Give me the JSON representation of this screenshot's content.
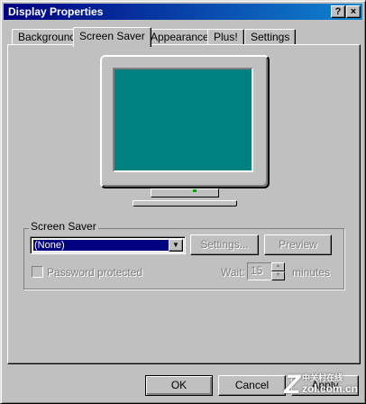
{
  "window": {
    "title": "Display Properties",
    "help_glyph": "?",
    "close_glyph": "×"
  },
  "tabs": [
    {
      "label": "Background",
      "active": false
    },
    {
      "label": "Screen Saver",
      "active": true
    },
    {
      "label": "Appearance",
      "active": false
    },
    {
      "label": "Plus!",
      "active": false
    },
    {
      "label": "Settings",
      "active": false
    }
  ],
  "preview": {
    "screen_color": "#008080"
  },
  "screen_saver": {
    "group_label": "Screen Saver",
    "selected": "(None)",
    "settings_label": "Settings...",
    "preview_label": "Preview",
    "password_label": "Password protected",
    "password_checked": false,
    "wait_label": "Wait:",
    "wait_value": "15",
    "wait_units": "minutes"
  },
  "buttons": {
    "ok": "OK",
    "cancel": "Cancel",
    "apply": "Apply"
  },
  "watermark": {
    "logo": "Z",
    "text_cn": "中关村在线",
    "url": "zol.com.cn"
  },
  "colors": {
    "title_bar": "#000080",
    "face": "#c0c0c0",
    "selection": "#000080"
  }
}
